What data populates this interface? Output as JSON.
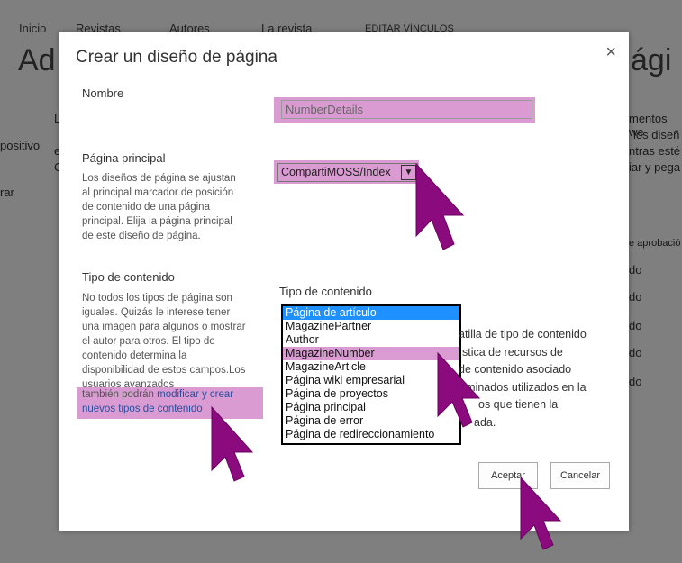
{
  "background": {
    "nav": [
      "Inicio",
      "Revistas",
      "Autores",
      "La revista",
      "EDITAR VÍNCULOS"
    ],
    "title_left": "Ad",
    "title_right": "ági",
    "left_fragments": [
      "L",
      "positivo",
      "e",
      "C",
      "rar"
    ],
    "right_fragments": [
      "mentos we",
      "los diseñ",
      "ntras esté",
      "iar y pega",
      "e aprobació",
      "do",
      "do",
      "do",
      "do",
      "do"
    ]
  },
  "dialog": {
    "title": "Crear un diseño de página",
    "close_glyph": "×",
    "name_label": "Nombre",
    "name_value": "NumberDetails",
    "master_label": "Página principal",
    "master_desc": "Los diseños de página se ajustan al principal marcador de posición de contenido de una página principal. Elija la página principal de este diseño de página.",
    "master_value": "CompartiMOSS/Index",
    "ct_label": "Tipo de contenido",
    "ct_desc_plain": "No todos los tipos de página son iguales. Quizás le interese tener una imagen para algunos o mostrar el autor para otros. El tipo de contenido determina la disponibilidad de estos campos.Los usuarios avanzados",
    "ct_desc_hl": "también podrán ",
    "ct_desc_link": "modificar y crear nuevos tipos de contenido",
    "ct_list_label": "Tipo de contenido",
    "ct_options": [
      "Página de artículo",
      "MagazinePartner",
      "Author",
      "MagazineNumber",
      "MagazineArticle",
      "Página wiki empresarial",
      "Página de proyectos",
      "Página principal",
      "Página de error",
      "Página de redireccionamiento"
    ],
    "ct_selected": "Página de artículo",
    "ct_highlighted": "MagazineNumber",
    "ct_side_text": [
      "atilla de tipo de contenido",
      "stica de recursos de",
      "de contenido asociado",
      "rminados utilizados en la",
      "os que tienen la",
      "ada."
    ],
    "ok_label": "Aceptar",
    "cancel_label": "Cancelar"
  },
  "colors": {
    "highlight": "#d99bd1",
    "selected": "#1e90ff",
    "cursor": "#8b0a7e"
  },
  "icons": [
    "close-icon",
    "dropdown-arrow-icon",
    "pointer-cursor-icon"
  ]
}
